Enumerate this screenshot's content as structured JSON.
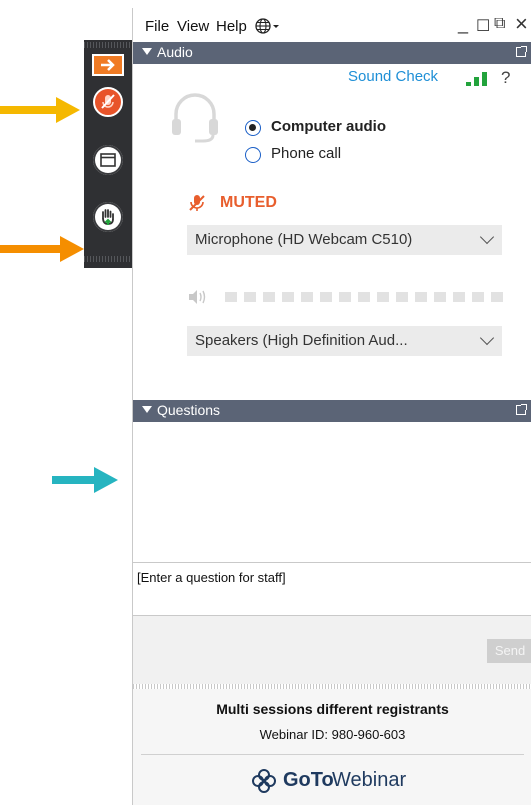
{
  "menu": {
    "file": "File",
    "view": "View",
    "help": "Help"
  },
  "window_controls": {
    "minimize": "_",
    "restore": "☐",
    "popout": "⧉",
    "close": "×"
  },
  "audio_panel": {
    "title": "Audio",
    "sound_check": "Sound Check",
    "help_symbol": "?",
    "options": [
      {
        "label": "Computer audio",
        "selected": true
      },
      {
        "label": "Phone call",
        "selected": false
      }
    ],
    "status": "MUTED",
    "microphone": "Microphone (HD Webcam C510)",
    "speakers": "Speakers (High Definition Aud..."
  },
  "questions_panel": {
    "title": "Questions",
    "input_placeholder": "[Enter a question for staff]",
    "send_label": "Send"
  },
  "footer": {
    "webinar_title": "Multi sessions different registrants",
    "webinar_id": "Webinar ID: 980-960-603",
    "logo_goto": "GoTo",
    "logo_webinar": "Webinar"
  },
  "colors": {
    "arrow_yellow": "#f5b800",
    "arrow_orange": "#f58e00",
    "arrow_teal": "#26b4c0",
    "accent_orange": "#e85e2d",
    "panel_header": "#5b6476",
    "link_blue": "#1e8fd6"
  }
}
